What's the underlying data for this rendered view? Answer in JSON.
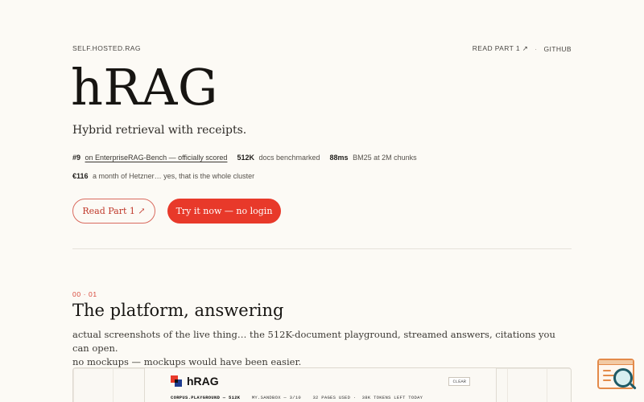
{
  "nav": {
    "brand": "SELF.HOSTED.RAG",
    "read_part": "READ PART 1 ↗",
    "separator": "·",
    "github": "GITHUB"
  },
  "hero": {
    "title": "hRAG",
    "tagline": "Hybrid retrieval with receipts.",
    "stats": [
      {
        "value": "#9",
        "label": "on EnterpriseRAG-Bench — officially scored"
      },
      {
        "value": "512K",
        "label": "docs benchmarked"
      },
      {
        "value": "88ms",
        "label": "BM25 at 2M chunks"
      }
    ],
    "cost": {
      "value": "€116",
      "label": "a month of Hetzner… yes, that is the whole cluster"
    },
    "buttons": {
      "read": "Read Part 1 ↗",
      "try": "Try it now — no login"
    }
  },
  "section": {
    "number": "00 · 01",
    "title": "The platform, answering",
    "desc_line1": "actual screenshots of the live thing… the 512K-document playground, streamed answers, citations you can open.",
    "desc_line2": "no mockups — mockups would have been easier."
  },
  "preview": {
    "brand": "hRAG",
    "clear": "CLEAR",
    "corpus": "CORPUS.PLAYGROUND — 512K",
    "sandbox": "MY.SANDBOX — 3/10",
    "pages": "32 PAGES USED",
    "tokens": "38K TOKENS LEFT TODAY"
  },
  "colors": {
    "accent": "#e8392a",
    "background": "#fcfaf5",
    "logo_blue": "#1d3b8f"
  },
  "icons": {
    "widget": "search-widget-icon"
  }
}
